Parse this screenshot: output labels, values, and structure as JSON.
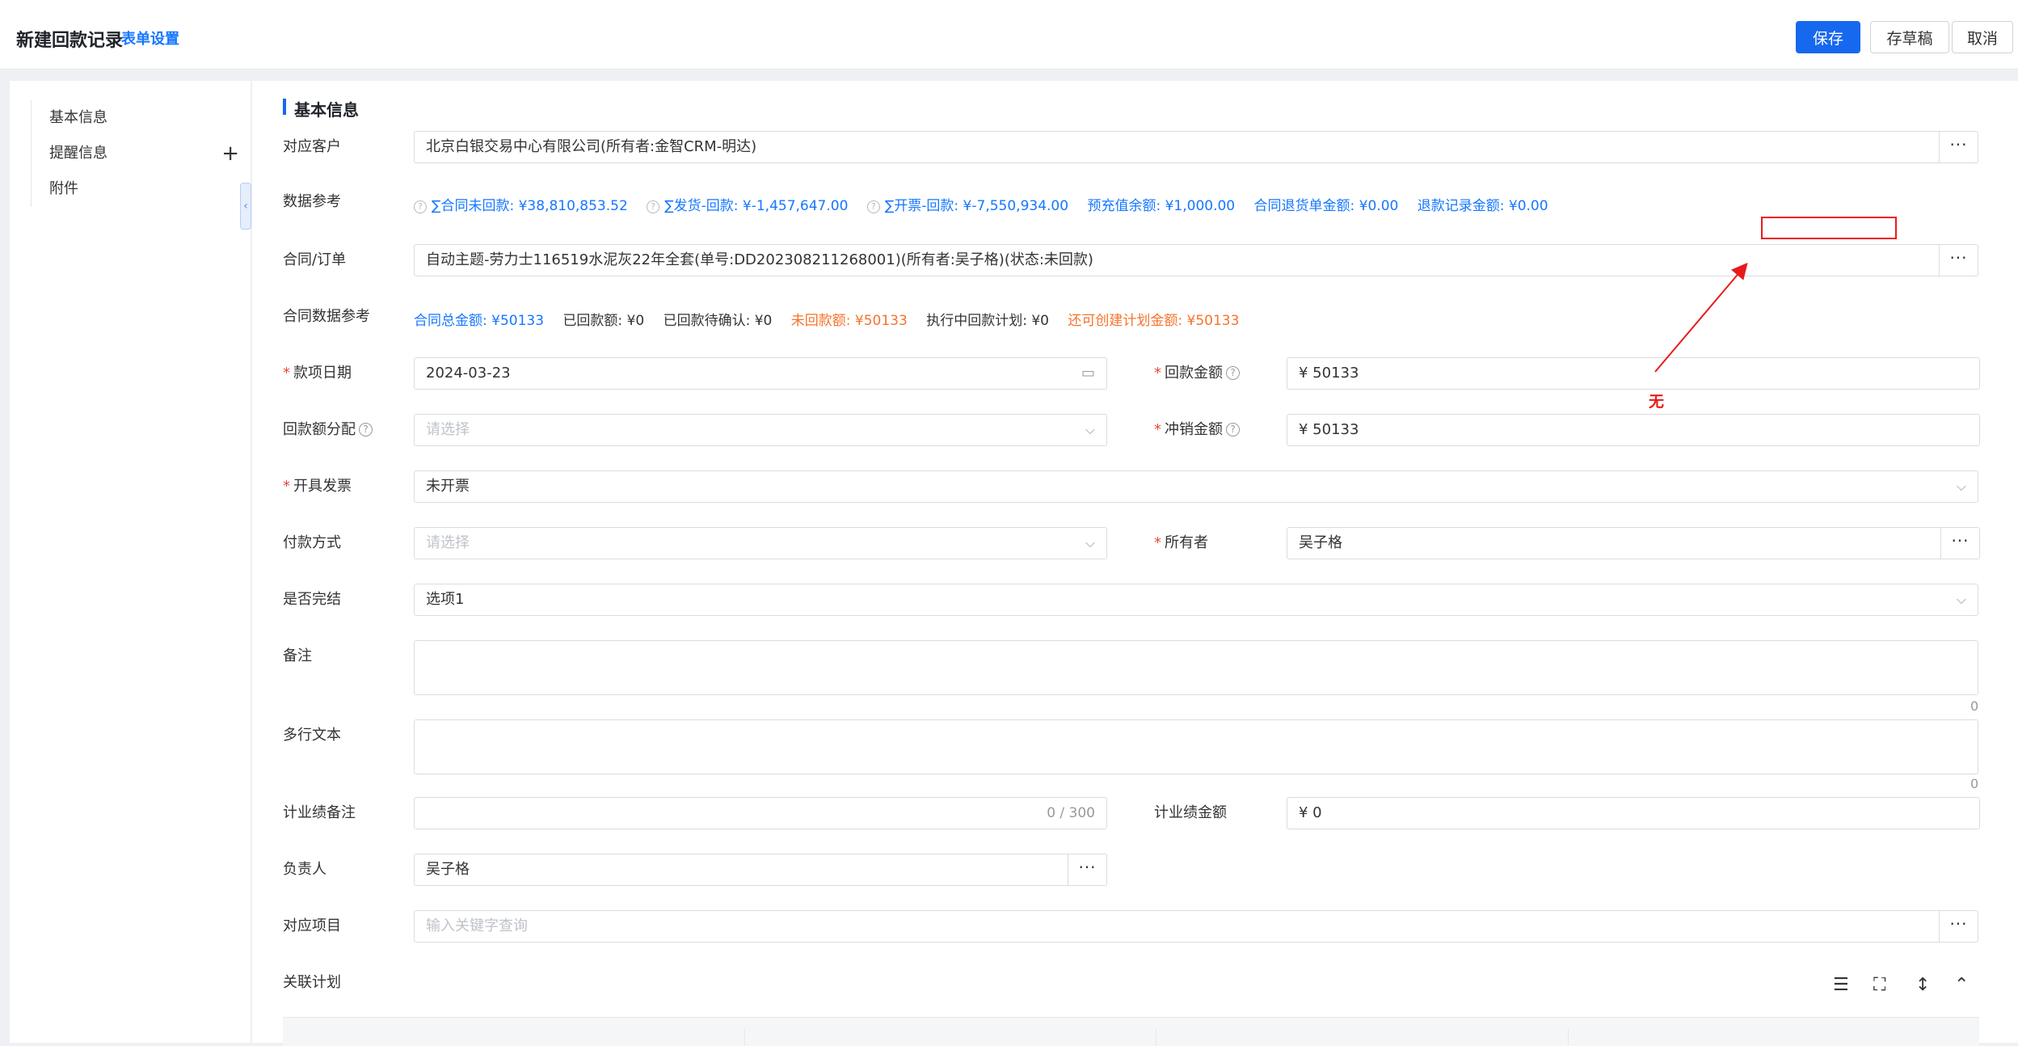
{
  "header": {
    "title": "新建回款记录",
    "form_settings": "表单设置",
    "save": "保存",
    "draft": "存草稿",
    "cancel": "取消"
  },
  "sidebar": {
    "items": [
      {
        "label": "基本信息"
      },
      {
        "label": "提醒信息"
      },
      {
        "label": "附件"
      }
    ],
    "collapse_icon": "chevron-left-icon"
  },
  "section": {
    "title": "基本信息"
  },
  "fields": {
    "customer": {
      "label": "对应客户",
      "value": "北京白银交易中心有限公司(所有者:金智CRM-明达)"
    },
    "data_ref": {
      "label": "数据参考",
      "items": [
        "∑合同未回款: ¥38,810,853.52",
        "∑发货-回款: ¥-1,457,647.00",
        "∑开票-回款: ¥-7,550,934.00",
        "预充值余额: ¥1,000.00",
        "合同退货单金额: ¥0.00",
        "退款记录金额: ¥0.00"
      ]
    },
    "contract": {
      "label": "合同/订单",
      "value": "自动主题-劳力士116519水泥灰22年全套(单号:DD202308211268001)(所有者:吴子格)(状态:未回款)"
    },
    "contract_ref": {
      "label": "合同数据参考",
      "items": [
        {
          "text": "合同总金额: ¥50133",
          "color": "#1677ff"
        },
        {
          "text": "已回款额: ¥0",
          "color": "#333333"
        },
        {
          "text": "已回款待确认: ¥0",
          "color": "#333333"
        },
        {
          "text": "未回款额: ¥50133",
          "color": "#f5732b"
        },
        {
          "text": "执行中回款计划: ¥0",
          "color": "#333333"
        },
        {
          "text": "还可创建计划金额: ¥50133",
          "color": "#f5732b"
        }
      ]
    },
    "payment_date": {
      "label": "款项日期",
      "value": "2024-03-23"
    },
    "payment_amount": {
      "label": "回款金额",
      "value": "¥ 50133"
    },
    "allocation": {
      "label": "回款额分配",
      "placeholder": "请选择"
    },
    "writeoff_amount": {
      "label": "冲销金额",
      "value": "¥ 50133"
    },
    "invoice": {
      "label": "开具发票",
      "value": "未开票"
    },
    "pay_method": {
      "label": "付款方式",
      "placeholder": "请选择"
    },
    "owner": {
      "label": "所有者",
      "value": "吴子格"
    },
    "completed": {
      "label": "是否完结",
      "value": "选项1"
    },
    "remark": {
      "label": "备注",
      "count": "0"
    },
    "multiline": {
      "label": "多行文本",
      "count": "0"
    },
    "perf_remark": {
      "label": "计业绩备注",
      "count": "0 / 300"
    },
    "perf_amount": {
      "label": "计业绩金额",
      "value": "¥ 0"
    },
    "manager": {
      "label": "负责人",
      "value": "吴子格"
    },
    "project": {
      "label": "对应项目",
      "placeholder": "输入关键字查询"
    },
    "plan": {
      "label": "关联计划"
    }
  },
  "annotation": {
    "text": "无"
  }
}
